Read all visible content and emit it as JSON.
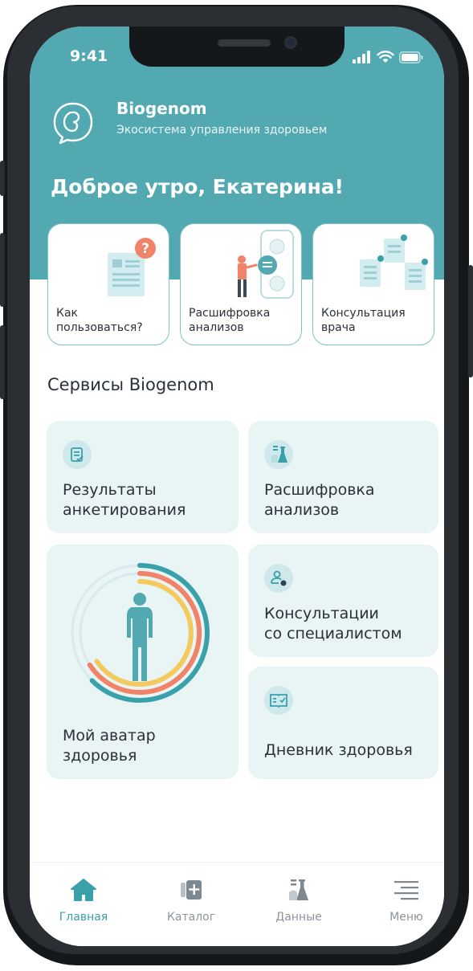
{
  "status_bar": {
    "time": "9:41"
  },
  "header": {
    "app_name": "Biogenom",
    "tagline": "Экосистема управления здоровьем",
    "greeting": "Доброе утро, Екатерина!"
  },
  "quick_cards": [
    {
      "label": "Как\nпользоваться?"
    },
    {
      "label": "Расшифровка\nанализов"
    },
    {
      "label": "Консультация\nврача"
    }
  ],
  "services": {
    "title": "Сервисы Biogenom",
    "items": [
      {
        "label": "Результаты\nанкетирования",
        "icon": "survey-icon"
      },
      {
        "label": "Расшифровка\nанализов",
        "icon": "flask-icon"
      },
      {
        "label": "Мой аватар\nздоровья",
        "icon": "body-avatar-icon"
      },
      {
        "label": "Консультации\nсо специалистом",
        "icon": "specialist-icon"
      },
      {
        "label": "Дневник здоровья",
        "icon": "diary-icon"
      }
    ]
  },
  "tabbar": [
    {
      "label": "Главная",
      "icon": "home-icon",
      "active": true
    },
    {
      "label": "Каталог",
      "icon": "catalog-icon",
      "active": false
    },
    {
      "label": "Данные",
      "icon": "data-icon",
      "active": false
    },
    {
      "label": "Меню",
      "icon": "menu-icon",
      "active": false
    }
  ],
  "colors": {
    "brand": "#53a9b1",
    "accent": "#3aa0a9",
    "card_bg": "#e9f4f5",
    "ring_teal": "#3aa0a9",
    "ring_coral": "#f08368",
    "ring_yellow": "#f4c95d"
  }
}
